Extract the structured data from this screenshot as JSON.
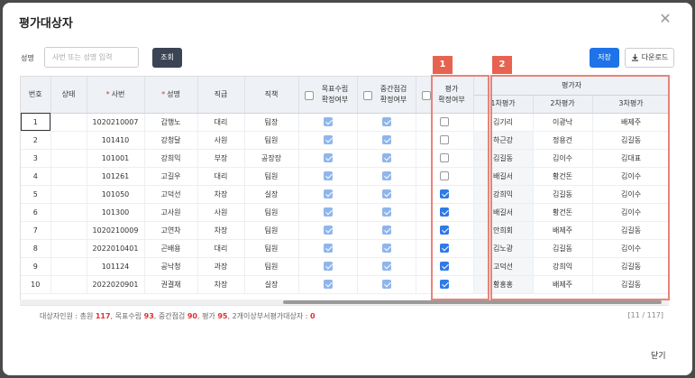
{
  "dialog": {
    "title": "평가대상자",
    "close_icon": "close-icon"
  },
  "search": {
    "label": "성명",
    "placeholder": "사번 또는 성명 입력",
    "button": "조회"
  },
  "toolbar": {
    "save": "저장",
    "download": "다운로드"
  },
  "annotations": {
    "badge1": "1",
    "badge2": "2",
    "box_color": "#e8847a"
  },
  "columns": {
    "no": "번호",
    "status": "상태",
    "emp_id": "사번",
    "name": "성명",
    "rank": "직급",
    "position": "직책",
    "goal": "목표수립\n확정여부",
    "mid": "중간점검\n확정여부",
    "eval": "평가\n확정여부",
    "evaluator_group": "평가자",
    "eval1": "1차평가",
    "eval2": "2차평가",
    "eval3": "3차평가"
  },
  "rows": [
    {
      "no": "1",
      "status": "",
      "emp_id": "1020210007",
      "name": "갑행노",
      "rank": "대리",
      "position": "팀장",
      "goal": true,
      "mid": true,
      "eval": false,
      "e1": "김기리",
      "e2": "이광낙",
      "e3": "배제주"
    },
    {
      "no": "2",
      "status": "",
      "emp_id": "101410",
      "name": "강청달",
      "rank": "사원",
      "position": "팀원",
      "goal": true,
      "mid": true,
      "eval": false,
      "e1": "하근강",
      "e2": "정용건",
      "e3": "김길동"
    },
    {
      "no": "3",
      "status": "",
      "emp_id": "101001",
      "name": "강희익",
      "rank": "부장",
      "position": "공장장",
      "goal": true,
      "mid": true,
      "eval": false,
      "e1": "김길동",
      "e2": "김이수",
      "e3": "김대표"
    },
    {
      "no": "4",
      "status": "",
      "emp_id": "101261",
      "name": "고길우",
      "rank": "대리",
      "position": "팀원",
      "goal": true,
      "mid": true,
      "eval": false,
      "e1": "배길서",
      "e2": "황건돈",
      "e3": "김이수"
    },
    {
      "no": "5",
      "status": "",
      "emp_id": "101050",
      "name": "고덕선",
      "rank": "차장",
      "position": "실장",
      "goal": true,
      "mid": true,
      "eval": true,
      "e1": "강희익",
      "e2": "김길동",
      "e3": "김이수"
    },
    {
      "no": "6",
      "status": "",
      "emp_id": "101300",
      "name": "고사원",
      "rank": "사원",
      "position": "팀원",
      "goal": true,
      "mid": true,
      "eval": true,
      "e1": "배길서",
      "e2": "황건돈",
      "e3": "김이수"
    },
    {
      "no": "7",
      "status": "",
      "emp_id": "1020210009",
      "name": "고연차",
      "rank": "차장",
      "position": "팀원",
      "goal": true,
      "mid": true,
      "eval": true,
      "e1": "안희회",
      "e2": "배제주",
      "e3": "김길동"
    },
    {
      "no": "8",
      "status": "",
      "emp_id": "2022010401",
      "name": "곤배용",
      "rank": "대리",
      "position": "팀원",
      "goal": true,
      "mid": true,
      "eval": true,
      "e1": "김노광",
      "e2": "김길동",
      "e3": "김이수"
    },
    {
      "no": "9",
      "status": "",
      "emp_id": "101124",
      "name": "공낙청",
      "rank": "과장",
      "position": "팀원",
      "goal": true,
      "mid": true,
      "eval": true,
      "e1": "고덕선",
      "e2": "강희익",
      "e3": "김길동"
    },
    {
      "no": "10",
      "status": "",
      "emp_id": "2022020901",
      "name": "권결재",
      "rank": "차장",
      "position": "실장",
      "goal": true,
      "mid": true,
      "eval": true,
      "e1": "황홍홍",
      "e2": "배제주",
      "e3": "김길동"
    }
  ],
  "summary": {
    "prefix": "대상자인원 : 총원 ",
    "total": "117",
    "goal_label": ", 목표수립 ",
    "goal": "93",
    "mid_label": ", 중간점검 ",
    "mid": "90",
    "eval_label": ", 평가 ",
    "eval": "95",
    "two_label": ", 2개이상부서평가대상자 : ",
    "two": "0",
    "page": "[11 / 117]"
  },
  "footer": {
    "close": "닫기"
  }
}
